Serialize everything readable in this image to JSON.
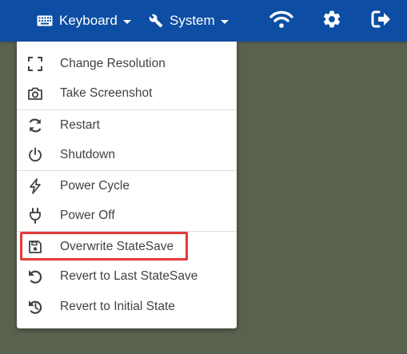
{
  "topbar": {
    "keyboard_label": "Keyboard",
    "system_label": "System",
    "icons": {
      "keyboard": "keyboard-icon",
      "system": "wrench-icon",
      "wifi": "wifi-icon",
      "settings": "gear-icon",
      "logout": "logout-icon"
    },
    "bg_color": "#0d4ea4"
  },
  "menu": {
    "items": [
      {
        "label": "Change Resolution",
        "icon": "fullscreen-icon"
      },
      {
        "label": "Take Screenshot",
        "icon": "camera-icon"
      },
      {
        "label": "Restart",
        "icon": "restart-icon"
      },
      {
        "label": "Shutdown",
        "icon": "power-icon"
      },
      {
        "label": "Power Cycle",
        "icon": "bolt-icon"
      },
      {
        "label": "Power Off",
        "icon": "plug-icon"
      },
      {
        "label": "Overwrite StateSave",
        "icon": "save-icon"
      },
      {
        "label": "Revert to Last StateSave",
        "icon": "undo-icon"
      },
      {
        "label": "Revert to Initial State",
        "icon": "history-icon"
      }
    ],
    "highlighted_item": "Overwrite StateSave",
    "highlight_color": "#e53a3a"
  },
  "background_color": "#59614f"
}
